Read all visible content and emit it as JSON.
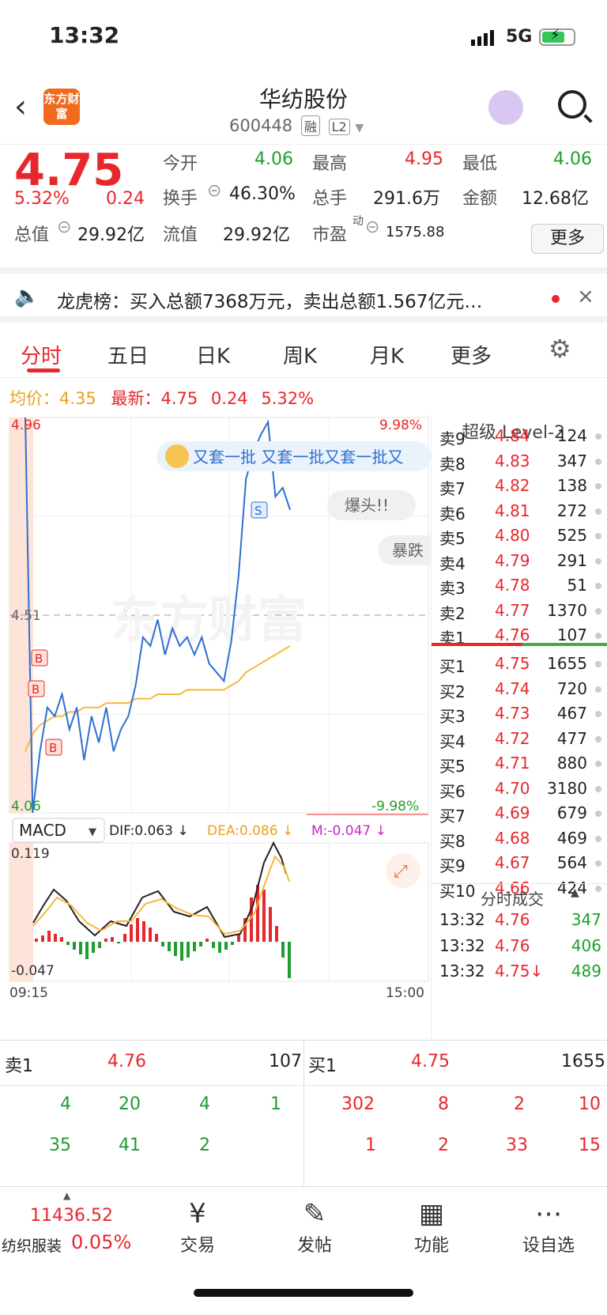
{
  "status": {
    "time": "13:32",
    "network": "5G"
  },
  "header": {
    "title": "华纺股份",
    "code": "600448",
    "tag1": "融",
    "tag2": "L2",
    "logo": "东方财富"
  },
  "quote": {
    "price": "4.75",
    "pct": "5.32%",
    "chg": "0.24",
    "open_label": "今开",
    "open": "4.06",
    "high_label": "最高",
    "high": "4.95",
    "low_label": "最低",
    "low": "4.06",
    "turnover_label": "换手",
    "turnover": "46.30%",
    "vol_label": "总手",
    "vol": "291.6万",
    "amt_label": "金额",
    "amt": "12.68亿",
    "mcap_label": "总值",
    "mcap": "29.92亿",
    "float_label": "流值",
    "float": "29.92亿",
    "pe_label": "市盈",
    "pe_sup": "动",
    "pe": "1575.88",
    "more": "更多"
  },
  "news": {
    "text": "龙虎榜：买入总额7368万元，卖出总额1.567亿元…"
  },
  "tabs": [
    "分时",
    "五日",
    "日K",
    "周K",
    "月K",
    "更多"
  ],
  "info": {
    "avg_label": "均价：",
    "avg": "4.35",
    "new_label": "最新：",
    "new": "4.75",
    "chg": "0.24",
    "pct": "5.32%"
  },
  "chart_data": {
    "type": "line",
    "ymax": "4.96",
    "ymin": "4.06",
    "mid": "4.51",
    "pmax": "9.98%",
    "pmin": "-9.98%",
    "start": "09:15",
    "end": "15:00",
    "bubbles": [
      "又套一批 又套一批又套一批又",
      "爆头!!",
      "暴跌"
    ],
    "watermark": "东方财富",
    "macd": {
      "label": "MACD",
      "dif": "DIF:0.063 ↓",
      "dea": "DEA:0.086 ↓",
      "m": "M:-0.047 ↓",
      "top": "0.119",
      "bottom": "-0.047"
    },
    "price_series": [
      4.96,
      4.06,
      4.2,
      4.3,
      4.28,
      4.33,
      4.25,
      4.3,
      4.18,
      4.28,
      4.22,
      4.3,
      4.2,
      4.25,
      4.28,
      4.35,
      4.46,
      4.44,
      4.5,
      4.42,
      4.48,
      4.44,
      4.46,
      4.42,
      4.46,
      4.4,
      4.38,
      4.36,
      4.45,
      4.6,
      4.82,
      4.88,
      4.92,
      4.95,
      4.78,
      4.8,
      4.75
    ],
    "avg_series": [
      4.2,
      4.24,
      4.26,
      4.27,
      4.28,
      4.28,
      4.29,
      4.29,
      4.3,
      4.3,
      4.3,
      4.31,
      4.31,
      4.31,
      4.31,
      4.32,
      4.32,
      4.32,
      4.33,
      4.33,
      4.33,
      4.33,
      4.34,
      4.34,
      4.34,
      4.34,
      4.34,
      4.34,
      4.35,
      4.36,
      4.38,
      4.39,
      4.4,
      4.41,
      4.42,
      4.43,
      4.44
    ]
  },
  "level2": {
    "title": "超级 Level-2",
    "sells": [
      [
        "卖9",
        "4.84",
        "124"
      ],
      [
        "卖8",
        "4.83",
        "347"
      ],
      [
        "卖7",
        "4.82",
        "138"
      ],
      [
        "卖6",
        "4.81",
        "272"
      ],
      [
        "卖5",
        "4.80",
        "525"
      ],
      [
        "卖4",
        "4.79",
        "291"
      ],
      [
        "卖3",
        "4.78",
        "51"
      ],
      [
        "卖2",
        "4.77",
        "1370"
      ],
      [
        "卖1",
        "4.76",
        "107"
      ]
    ],
    "buys": [
      [
        "买1",
        "4.75",
        "1655"
      ],
      [
        "买2",
        "4.74",
        "720"
      ],
      [
        "买3",
        "4.73",
        "467"
      ],
      [
        "买4",
        "4.72",
        "477"
      ],
      [
        "买5",
        "4.71",
        "880"
      ],
      [
        "买6",
        "4.70",
        "3180"
      ],
      [
        "买7",
        "4.69",
        "679"
      ],
      [
        "买8",
        "4.68",
        "469"
      ],
      [
        "买9",
        "4.67",
        "564"
      ],
      [
        "买10",
        "4.66",
        "424"
      ]
    ],
    "ticks_title": "分时成交",
    "ticks": [
      [
        "13:32",
        "4.76",
        "347"
      ],
      [
        "13:32",
        "4.76",
        "406"
      ],
      [
        "13:32",
        "4.75↓",
        "489"
      ]
    ]
  },
  "queue": {
    "sell_label": "卖1",
    "sell_price": "4.76",
    "sell_vol": "107",
    "buy_label": "买1",
    "buy_price": "4.75",
    "buy_vol": "1655",
    "sell_row1": [
      "4",
      "20",
      "4",
      "1"
    ],
    "sell_row2": [
      "35",
      "41",
      "2"
    ],
    "buy_row1": [
      "302",
      "8",
      "2",
      "10"
    ],
    "buy_row2": [
      "1",
      "2",
      "33",
      "15"
    ]
  },
  "index": {
    "value": "11436.52",
    "name": "纺织服装",
    "pct": "0.05%"
  },
  "tabbar": [
    "交易",
    "发帖",
    "功能",
    "设自选"
  ]
}
